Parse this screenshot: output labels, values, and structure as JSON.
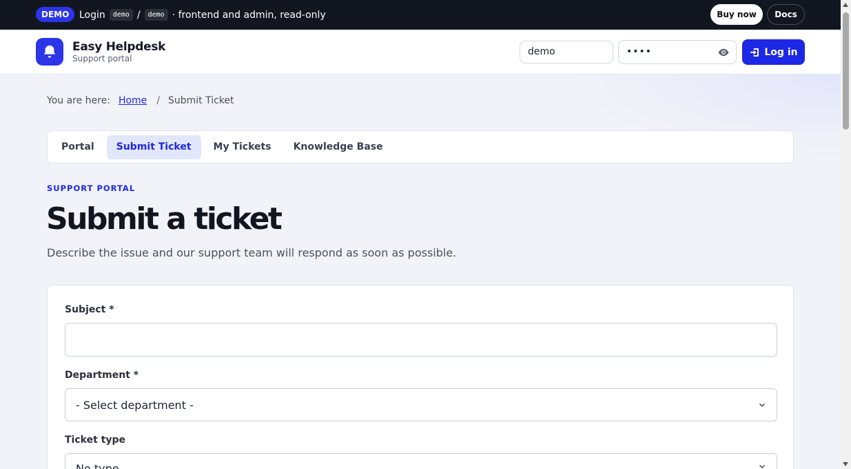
{
  "demo_bar": {
    "badge": "DEMO",
    "login_label": "Login",
    "user_code": "demo",
    "slash": "/",
    "pass_code": "demo",
    "note": "· frontend and admin, read-only",
    "buy_now": "Buy now",
    "docs": "Docs"
  },
  "header": {
    "brand_name": "Easy Helpdesk",
    "brand_sub": "Support portal",
    "username_value": "demo",
    "password_value": "••••",
    "login_button": "Log in",
    "logo_icon": "bell-icon",
    "accent": "#1d27e6"
  },
  "breadcrumb": {
    "prefix": "You are here:",
    "home": "Home",
    "separator": "/",
    "current": "Submit Ticket"
  },
  "tabs": [
    {
      "label": "Portal",
      "active": false
    },
    {
      "label": "Submit Ticket",
      "active": true
    },
    {
      "label": "My Tickets",
      "active": false
    },
    {
      "label": "Knowledge Base",
      "active": false
    }
  ],
  "main": {
    "eyebrow": "SUPPORT PORTAL",
    "title": "Submit a ticket",
    "description": "Describe the issue and our support team will respond as soon as possible."
  },
  "form": {
    "subject_label": "Subject *",
    "subject_value": "",
    "department_label": "Department *",
    "department_selected": "- Select department -",
    "ticket_type_label": "Ticket type",
    "ticket_type_selected": "No type"
  }
}
